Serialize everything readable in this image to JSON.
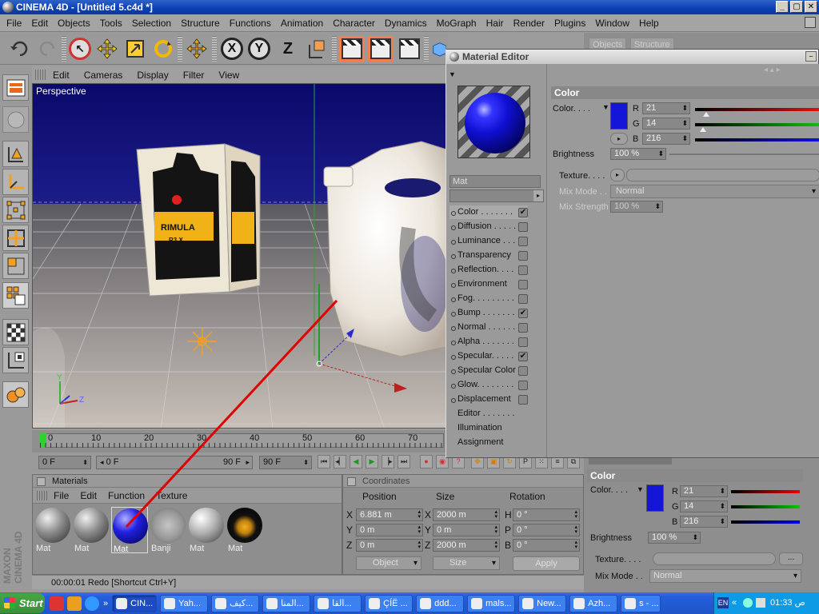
{
  "window": {
    "title": "CINEMA 4D - [Untitled 5.c4d *]",
    "buttons": [
      "_",
      "▢",
      "✕"
    ]
  },
  "menubar": [
    "File",
    "Edit",
    "Objects",
    "Tools",
    "Selection",
    "Structure",
    "Functions",
    "Animation",
    "Character",
    "Dynamics",
    "MoGraph",
    "Hair",
    "Render",
    "Plugins",
    "Window",
    "Help"
  ],
  "toolbar": {
    "axis_labels": [
      "X",
      "Y",
      "Z"
    ]
  },
  "viewport": {
    "menu": [
      "Edit",
      "Cameras",
      "Display",
      "Filter",
      "View"
    ],
    "label": "Perspective",
    "bottle_text": [
      "RIMULA",
      "R3 X",
      "RIMULA"
    ]
  },
  "timeline": {
    "ticks": [
      "0",
      "10",
      "20",
      "30",
      "40",
      "50",
      "60",
      "70"
    ]
  },
  "anim_controls": {
    "current_frame": "0 F",
    "range_start": "0 F",
    "range_end": "90 F",
    "max_frame": "90 F"
  },
  "materials": {
    "title": "Materials",
    "menu": [
      "File",
      "Edit",
      "Function",
      "Texture"
    ],
    "items": [
      {
        "name": "Mat",
        "type": "grey"
      },
      {
        "name": "Mat",
        "type": "grey"
      },
      {
        "name": "Mat",
        "type": "blue"
      },
      {
        "name": "Banji",
        "type": "glass"
      },
      {
        "name": "Mat",
        "type": "white"
      },
      {
        "name": "Mat",
        "type": "label"
      }
    ]
  },
  "coordinates": {
    "title": "Coordinates",
    "headers": [
      "Position",
      "Size",
      "Rotation"
    ],
    "rows": [
      {
        "axis": "X",
        "pos": "6.881 m",
        "size_axis": "X",
        "size": "2000 m",
        "rot_axis": "H",
        "rot": "0 °"
      },
      {
        "axis": "Y",
        "pos": "0 m",
        "size_axis": "Y",
        "size": "0 m",
        "rot_axis": "P",
        "rot": "0 °"
      },
      {
        "axis": "Z",
        "pos": "0 m",
        "size_axis": "Z",
        "size": "2000 m",
        "rot_axis": "B",
        "rot": "0 °"
      }
    ],
    "mode": "Object",
    "size_mode": "Size",
    "apply": "Apply"
  },
  "status": {
    "text": "00:00:01   Redo [Shortcut Ctrl+Y]"
  },
  "objects_panel": {
    "tabs": [
      "Objects",
      "Structure"
    ]
  },
  "material_editor": {
    "title": "Material Editor",
    "name": "Mat",
    "channels": [
      {
        "label": "Color . . . . . . .",
        "checked": true
      },
      {
        "label": "Diffusion . . . . .",
        "checked": false
      },
      {
        "label": "Luminance . . . .",
        "checked": false
      },
      {
        "label": "Transparency",
        "checked": false
      },
      {
        "label": "Reflection. . . .",
        "checked": false
      },
      {
        "label": "Environment",
        "checked": false
      },
      {
        "label": "Fog. . . . . . . . .",
        "checked": false
      },
      {
        "label": "Bump . . . . . . .",
        "checked": true
      },
      {
        "label": "Normal . . . . . .",
        "checked": false
      },
      {
        "label": "Alpha . . . . . . .",
        "checked": false
      },
      {
        "label": "Specular. . . . .",
        "checked": true
      },
      {
        "label": "Specular Color",
        "checked": false
      },
      {
        "label": "Glow. . . . . . . .",
        "checked": false
      },
      {
        "label": "Displacement",
        "checked": false
      }
    ],
    "extra": [
      "Editor . . . . . . .",
      "Illumination",
      "Assignment"
    ],
    "section": "Color",
    "color_label": "Color. . . .",
    "r_label": "R",
    "g_label": "G",
    "b_label": "B",
    "r": "21",
    "g": "14",
    "b": "216",
    "brightness_label": "Brightness",
    "brightness": "100 %",
    "texture_label": "Texture. . . .",
    "mix_mode_label": "Mix Mode . .",
    "mix_mode": "Normal",
    "mix_strength_label": "Mix Strength",
    "mix_strength": "100 %",
    "color_hex": "#1510d8"
  },
  "attr_panel": {
    "section": "Color",
    "color_label": "Color. . . .",
    "r": "21",
    "g": "14",
    "b": "216",
    "brightness_label": "Brightness",
    "brightness": "100 %",
    "texture_label": "Texture. . . .",
    "mix_mode_label": "Mix Mode . .",
    "mix_mode": "Normal",
    "dots": "..."
  },
  "taskbar": {
    "start": "Start",
    "tasks": [
      "CIN...",
      "Yah...",
      "كيف...",
      "المنا...",
      "القا...",
      "ÇÍË ...",
      "ddd...",
      "mals...",
      "New...",
      "Azh...",
      "s - ..."
    ],
    "lang": "EN",
    "time": "ص 01:33"
  }
}
